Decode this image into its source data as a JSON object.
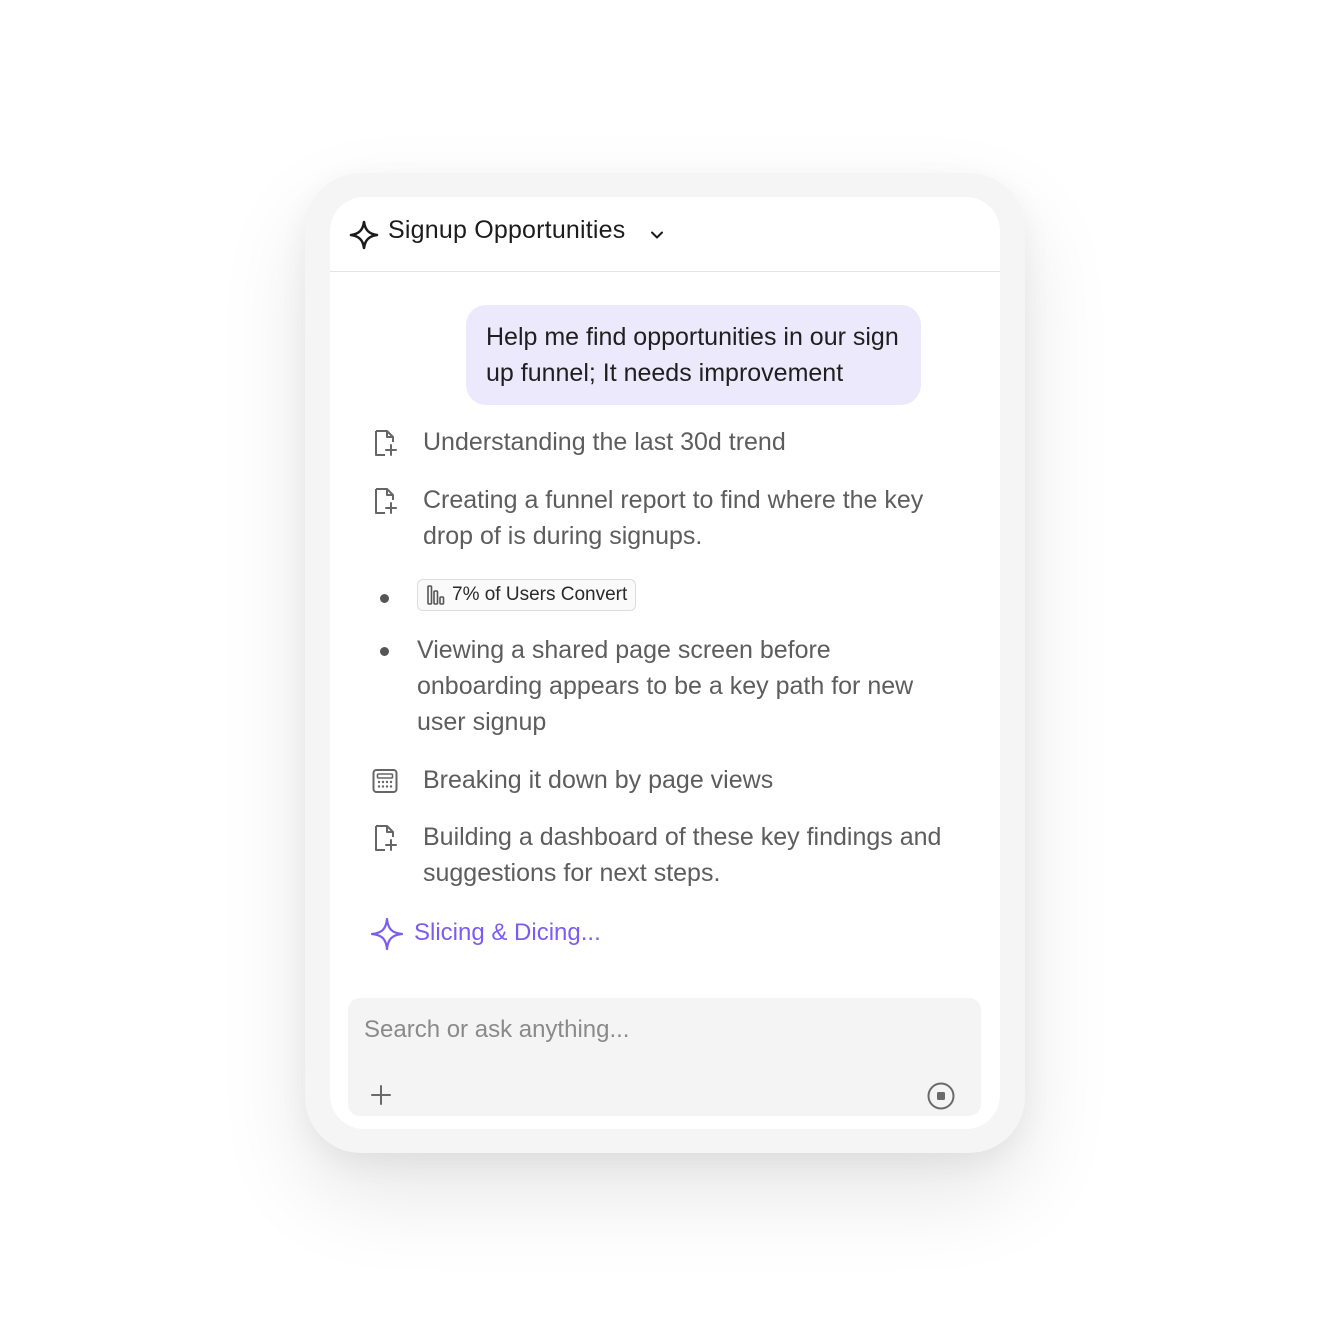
{
  "header": {
    "title": "Signup Opportunities",
    "icon": "sparkle-outline-icon",
    "dropdown_icon": "chevron-down-icon"
  },
  "user_message": "Help me find opportunities in our sign up funnel; It needs improvement",
  "steps": [
    {
      "icon": "file-plus-icon",
      "text": "Understanding the last 30d trend"
    },
    {
      "icon": "file-plus-icon",
      "text": "Creating a funnel report to find where the key drop of is during signups."
    },
    {
      "icon": "bullet",
      "chip": {
        "icon": "funnel-bars-icon",
        "label": "7% of Users Convert"
      }
    },
    {
      "icon": "bullet",
      "text": "Viewing a shared page screen before onboarding appears to be a key path for new user signup"
    },
    {
      "icon": "calculator-icon",
      "text": "Breaking it down by page views"
    },
    {
      "icon": "file-plus-icon",
      "text": "Building a dashboard of these key findings and suggestions for next steps."
    }
  ],
  "status": {
    "text": "Slicing & Dicing...",
    "icon": "sparkle-outline-icon"
  },
  "composer": {
    "placeholder": "Search or ask anything...",
    "value": "",
    "add_icon": "plus-icon",
    "stop_icon": "stop-circle-icon"
  },
  "colors": {
    "accent": "#7b5cf0",
    "user_bubble": "#ebe9fb",
    "step_text": "#5d5d5d",
    "composer_bg": "#f4f4f4"
  }
}
